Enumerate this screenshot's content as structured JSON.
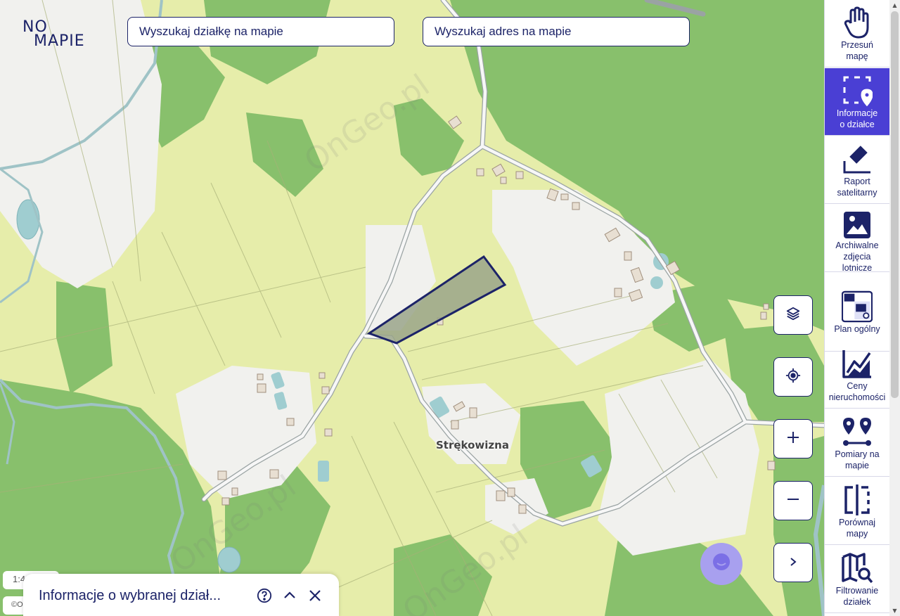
{
  "logo": {
    "line1": "NO",
    "line2": "MAPIE"
  },
  "search": {
    "parcel_placeholder": "Wyszukaj działkę na mapie",
    "address_placeholder": "Wyszukaj adres na mapie"
  },
  "map": {
    "place_label": "Strękowizna",
    "watermark": "OnGeo.pl",
    "scale_text": "1:4",
    "copyright_text": "©O"
  },
  "map_controls": {
    "layers": "layers-icon",
    "locate": "locate-icon",
    "zoom_in": "plus-icon",
    "zoom_out": "minus-icon",
    "expand": "play-icon"
  },
  "sidebar": {
    "items": [
      {
        "label": "Przesuń\nmapę",
        "icon": "hand-icon",
        "active": false
      },
      {
        "label": "Informacje\no działce",
        "icon": "parcel-info-icon",
        "active": true
      },
      {
        "label": "Raport\nsatelitarny",
        "icon": "satellite-icon",
        "active": false
      },
      {
        "label": "Archiwalne\nzdjęcia\nlotnicze",
        "icon": "image-icon",
        "active": false
      },
      {
        "label": "Plan ogólny",
        "icon": "plan-icon",
        "active": false
      },
      {
        "label": "Ceny\nnieruchomości",
        "icon": "chart-icon",
        "active": false
      },
      {
        "label": "Pomiary na\nmapie",
        "icon": "measure-icon",
        "active": false
      },
      {
        "label": "Porównaj\nmapy",
        "icon": "compare-icon",
        "active": false
      },
      {
        "label": "Filtrowanie\ndziałek",
        "icon": "filter-map-icon",
        "active": false
      }
    ]
  },
  "info_panel": {
    "title": "Informacje o wybranej dział..."
  },
  "colors": {
    "accent": "#4a3fd4",
    "navy": "#1c2368",
    "forest": "#86bf6a",
    "meadow": "#e6edaa",
    "parcel_fill": "#9aa58a"
  }
}
